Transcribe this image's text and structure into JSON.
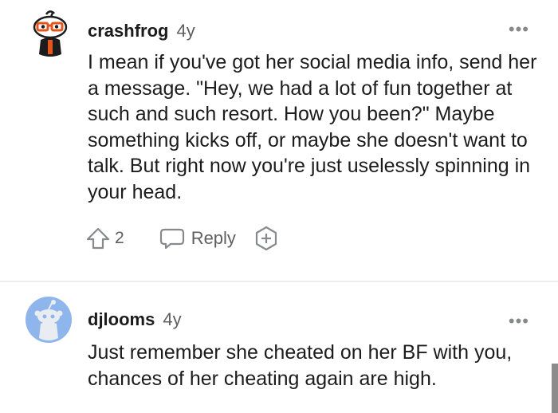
{
  "comments": [
    {
      "username": "crashfrog",
      "age": "4y",
      "more": "•••",
      "body": "I mean if you've got her social media info, send her a message. \"Hey, we had a lot of fun together at such and such resort. How you been?\" Maybe something kicks off, or maybe she doesn't want to talk. But right now you're just uselessly spinning in your head.",
      "votes": "2",
      "reply_label": "Reply",
      "avatar_icon": "snoo-avatar-glasses-icon"
    },
    {
      "username": "djlooms",
      "age": "4y",
      "more": "•••",
      "body": "Just remember she cheated on her BF with you, chances of her cheating again are high.",
      "avatar_icon": "snoo-avatar-default-icon",
      "avatar_color": "#8eb5ec"
    }
  ],
  "colors": {
    "text": "#1c1c1c",
    "muted": "#5f5f5f",
    "icon": "#878a8c"
  }
}
